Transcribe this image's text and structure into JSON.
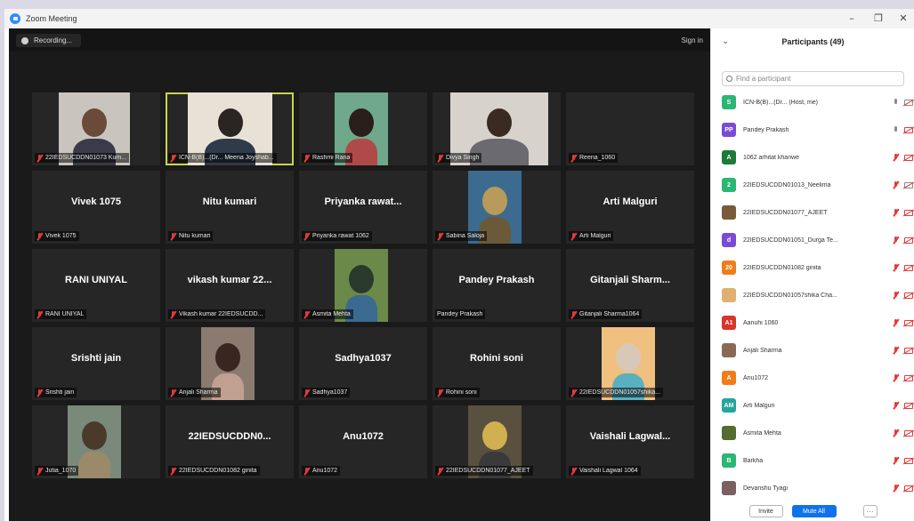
{
  "window": {
    "title": "Zoom Meeting",
    "minimize": "–",
    "maximize": "❐",
    "close": "✕"
  },
  "meeting": {
    "recording_label": "Recording...",
    "signin_label": "Sign in"
  },
  "tiles": [
    {
      "label": "22IEDSUCDDN01073 Kum...",
      "photo": true,
      "active": false
    },
    {
      "label": "ICN-B(B)...(Dr... Meena Joyshab...",
      "photo": true,
      "active": true
    },
    {
      "label": "Rashmi Rana",
      "photo": true,
      "active": false
    },
    {
      "label": "Divya Singh",
      "photo": true,
      "active": false
    },
    {
      "label": "Reena_1060",
      "name": "",
      "photo": false,
      "active": false
    },
    {
      "name": "Vivek 1075",
      "label": "Vivek 1075",
      "photo": false,
      "active": false
    },
    {
      "name": "Nitu kumari",
      "label": "Nitu kumari",
      "photo": false,
      "active": false
    },
    {
      "name": "Priyanka  rawat...",
      "label": "Priyanka rawat 1062",
      "photo": false,
      "active": false
    },
    {
      "label": "Sabina Saloja",
      "photo": true,
      "active": false
    },
    {
      "name": "Arti Malguri",
      "label": "Arti Malguri",
      "photo": false,
      "active": false
    },
    {
      "name": "RANI UNIYAL",
      "label": "RANI UNIYAL",
      "photo": false,
      "active": false
    },
    {
      "name": "vikash  kumar  22...",
      "label": "Vikash kumar 22IEDSUCDD...",
      "photo": false,
      "active": false
    },
    {
      "label": "Asmita Mehta",
      "photo": true,
      "active": false
    },
    {
      "name": "Pandey Prakash",
      "label": "Pandey Prakash",
      "photo": false,
      "active": false,
      "nomic": true
    },
    {
      "name": "Gitanjali  Sharm...",
      "label": "Gitanjali Sharma1064",
      "photo": false,
      "active": false
    },
    {
      "name": "Srishti jain",
      "label": "Srishti jain",
      "photo": false,
      "active": false
    },
    {
      "label": "Anjali Sharma",
      "photo": true,
      "active": false
    },
    {
      "name": "Sadhya1037",
      "label": "Sadhya1037",
      "photo": false,
      "active": false
    },
    {
      "name": "Rohini soni",
      "label": "Rohini soni",
      "photo": false,
      "active": false
    },
    {
      "label": "22IEDSUCDDN01057shika...",
      "photo": true,
      "active": false
    },
    {
      "label": "Jutia_1070",
      "photo": true,
      "active": false
    },
    {
      "name": "22IEDSUCDDN0...",
      "label": "22IEDSUCDDN01082 ginita",
      "photo": false,
      "active": false
    },
    {
      "name": "Anu1072",
      "label": "Anu1072",
      "photo": false,
      "active": false
    },
    {
      "label": "22IEDSUCDDN01077_AJEET",
      "photo": true,
      "active": false
    },
    {
      "name": "Vaishali  Lagwal...",
      "label": "Vaishali Lagwal 1064",
      "photo": false,
      "active": false
    }
  ],
  "participants_panel": {
    "collapse_icon": "⌄",
    "title": "Participants (49)",
    "search_placeholder": "Find a participant",
    "invite_label": "Invite",
    "mute_all_label": "Mute All",
    "more_label": "···",
    "participants": [
      {
        "initials": "S",
        "color": "#2bb673",
        "name": "ICN-B(B)...(Dr...  (Host, me)",
        "mic_on": true,
        "cam_off": false
      },
      {
        "initials": "PP",
        "color": "#7b4bd4",
        "name": "Pandey Prakash",
        "mic_on": true,
        "cam_off": true
      },
      {
        "initials": "A",
        "color": "#1e7a3a",
        "name": "1062 arhitat khanwe",
        "mic_on": false,
        "cam_off": true
      },
      {
        "initials": "2",
        "color": "#2bb673",
        "name": "22IEDSUCDDN01013_Neelima",
        "mic_on": false,
        "cam_off": false
      },
      {
        "initials": "",
        "color": "#7a5a3a",
        "name": "22IEDSUCDDN01077_AJEET",
        "mic_on": false,
        "cam_off": true
      },
      {
        "initials": "d",
        "color": "#7b4bd4",
        "name": "22IEDSUCDDN01051_Durga Te...",
        "mic_on": false,
        "cam_off": true
      },
      {
        "initials": "20",
        "color": "#f07c1a",
        "name": "22IEDSUCDDN01082 ginita",
        "mic_on": false,
        "cam_off": true
      },
      {
        "initials": "",
        "color": "#e0b070",
        "name": "22IEDSUCDDN01057shika Cha...",
        "mic_on": false,
        "cam_off": true
      },
      {
        "initials": "A1",
        "color": "#d9342b",
        "name": "Aanuhi 1060",
        "mic_on": false,
        "cam_off": true
      },
      {
        "initials": "",
        "color": "#8a6a55",
        "name": "Anjali Sharma",
        "mic_on": false,
        "cam_off": true
      },
      {
        "initials": "A",
        "color": "#f07c1a",
        "name": "Anu1072",
        "mic_on": false,
        "cam_off": true
      },
      {
        "initials": "AM",
        "color": "#26a69a",
        "name": "Arti Malguri",
        "mic_on": false,
        "cam_off": true
      },
      {
        "initials": "",
        "color": "#556b2f",
        "name": "Asmita Mehta",
        "mic_on": false,
        "cam_off": true
      },
      {
        "initials": "B",
        "color": "#2bb673",
        "name": "Barkha",
        "mic_on": false,
        "cam_off": true
      },
      {
        "initials": "",
        "color": "#7a6060",
        "name": "Devanshu Tyagi",
        "mic_on": false,
        "cam_off": true
      }
    ]
  }
}
